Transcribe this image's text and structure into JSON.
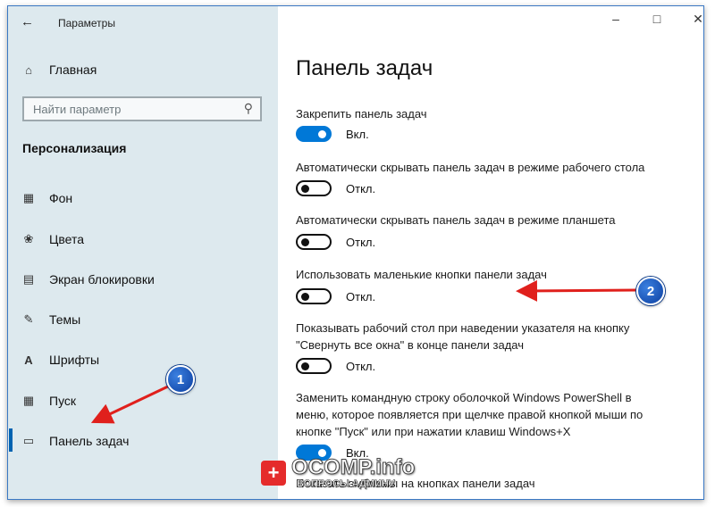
{
  "window": {
    "title": "Параметры"
  },
  "sidebar": {
    "home": {
      "label": "Главная"
    },
    "search": {
      "placeholder": "Найти параметр"
    },
    "section": "Персонализация",
    "items": [
      {
        "label": "Фон",
        "icon": "image-icon"
      },
      {
        "label": "Цвета",
        "icon": "palette-icon"
      },
      {
        "label": "Экран блокировки",
        "icon": "lock-screen-icon"
      },
      {
        "label": "Темы",
        "icon": "themes-icon"
      },
      {
        "label": "Шрифты",
        "icon": "fonts-icon"
      },
      {
        "label": "Пуск",
        "icon": "start-icon"
      },
      {
        "label": "Панель задач",
        "icon": "taskbar-icon",
        "active": true
      }
    ]
  },
  "main": {
    "title": "Панель задач",
    "settings": [
      {
        "label": "Закрепить панель задач",
        "state": "Вкл.",
        "on": true
      },
      {
        "label": "Автоматически скрывать панель задач в режиме рабочего стола",
        "state": "Откл.",
        "on": false
      },
      {
        "label": "Автоматически скрывать панель задач в режиме планшета",
        "state": "Откл.",
        "on": false
      },
      {
        "label": "Использовать маленькие кнопки панели задач",
        "state": "Откл.",
        "on": false
      },
      {
        "label": "Показывать рабочий стол при наведении указателя на кнопку \"Свернуть все окна\" в конце панели задач",
        "state": "Откл.",
        "on": false
      },
      {
        "label": "Заменить командную строку оболочкой Windows PowerShell в меню, которое появляется при щелчке правой кнопкой мыши по кнопке \"Пуск\" или при нажатии клавиш Windows+X",
        "state": "Вкл.",
        "on": true
      },
      {
        "label": "Показать эмблемы на кнопках панели задач"
      }
    ]
  },
  "annotations": {
    "badge1": "1",
    "badge2": "2",
    "arrow_color": "#e0201c"
  },
  "watermark": {
    "brand": "OCOMP.info",
    "sub": "ВОПРОСЫ АДМИНУ"
  },
  "colors": {
    "accent": "#0078d7",
    "sidebar_bg": "#dde9ee"
  }
}
